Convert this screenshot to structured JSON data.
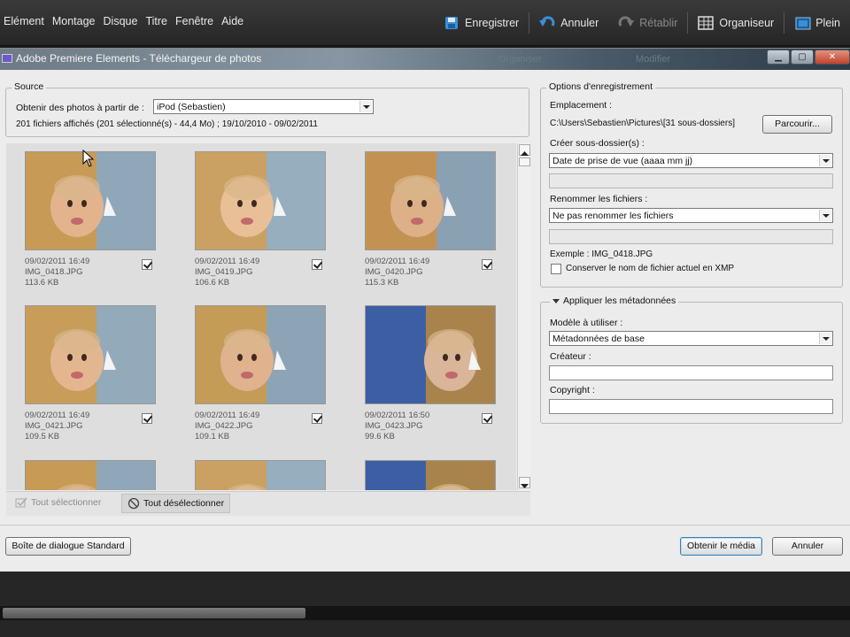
{
  "menubar": {
    "items": [
      "Elément",
      "Montage",
      "Disque",
      "Titre",
      "Fenêtre",
      "Aide"
    ],
    "tools": {
      "save": "Enregistrer",
      "undo": "Annuler",
      "redo": "Rétablir",
      "organizer": "Organiseur",
      "fullscreen": "Plein"
    }
  },
  "dialog": {
    "title": "Adobe Premiere Elements - Téléchargeur de photos",
    "ghost_tabs": [
      "Organiser",
      "Modifier"
    ],
    "source": {
      "legend": "Source",
      "get_from_label": "Obtenir des photos à partir de :",
      "get_from_value": "iPod (Sebastien)",
      "summary": "201 fichiers affichés (201 sélectionné(s) - 44,4 Mo) ; 19/10/2010 - 09/02/2011"
    },
    "thumbnails": [
      {
        "date": "09/02/2011 16:49",
        "name": "IMG_0418.JPG",
        "size": "113.6 KB",
        "checked": true
      },
      {
        "date": "09/02/2011 16:49",
        "name": "IMG_0419.JPG",
        "size": "106.6 KB",
        "checked": true
      },
      {
        "date": "09/02/2011 16:49",
        "name": "IMG_0420.JPG",
        "size": "115.3 KB",
        "checked": true
      },
      {
        "date": "09/02/2011 16:49",
        "name": "IMG_0421.JPG",
        "size": "109.5 KB",
        "checked": true
      },
      {
        "date": "09/02/2011 16:49",
        "name": "IMG_0422.JPG",
        "size": "109.1 KB",
        "checked": true
      },
      {
        "date": "09/02/2011 16:50",
        "name": "IMG_0423.JPG",
        "size": "99.6 KB",
        "checked": true
      }
    ],
    "select_all": "Tout sélectionner",
    "deselect_all": "Tout désélectionner",
    "save_options": {
      "legend": "Options d'enregistrement",
      "location_label": "Emplacement :",
      "location_value": "C:\\Users\\Sebastien\\Pictures\\[31 sous-dossiers]",
      "browse": "Parcourir...",
      "subfolder_label": "Créer sous-dossier(s) :",
      "subfolder_value": "Date de prise de vue (aaaa mm jj)",
      "rename_label": "Renommer les fichiers :",
      "rename_value": "Ne pas renommer les fichiers",
      "example": "Exemple : IMG_0418.JPG",
      "keep_name_label": "Conserver le nom de fichier actuel en XMP",
      "keep_name_checked": false
    },
    "metadata": {
      "legend": "Appliquer les métadonnées",
      "template_label": "Modèle à utiliser :",
      "template_value": "Métadonnées de base",
      "creator_label": "Créateur :",
      "copyright_label": "Copyright :"
    },
    "footer": {
      "standard_dialog": "Boîte de dialogue Standard",
      "get_media": "Obtenir le média",
      "cancel": "Annuler"
    }
  }
}
